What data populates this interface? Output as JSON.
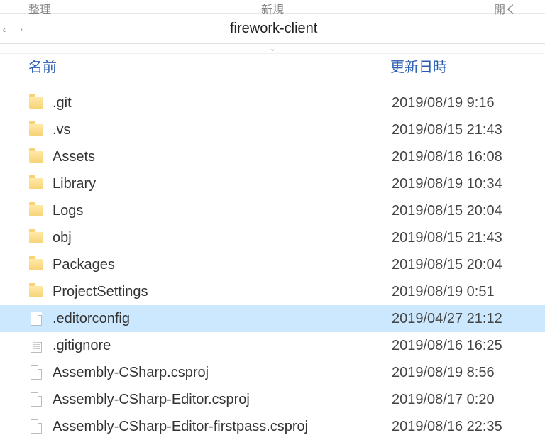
{
  "ribbon": {
    "group1": "整理",
    "group2": "新規",
    "group3": "開く"
  },
  "breadcrumb": {
    "current": "firework-client",
    "chevron": "⌄"
  },
  "columns": {
    "name": "名前",
    "date": "更新日時"
  },
  "files": [
    {
      "icon": "folder",
      "name": ".git",
      "date": "2019/08/19 9:16",
      "selected": false
    },
    {
      "icon": "folder",
      "name": ".vs",
      "date": "2019/08/15 21:43",
      "selected": false
    },
    {
      "icon": "folder",
      "name": "Assets",
      "date": "2019/08/18 16:08",
      "selected": false
    },
    {
      "icon": "folder",
      "name": "Library",
      "date": "2019/08/19 10:34",
      "selected": false
    },
    {
      "icon": "folder",
      "name": "Logs",
      "date": "2019/08/15 20:04",
      "selected": false
    },
    {
      "icon": "folder",
      "name": "obj",
      "date": "2019/08/15 21:43",
      "selected": false
    },
    {
      "icon": "folder",
      "name": "Packages",
      "date": "2019/08/15 20:04",
      "selected": false
    },
    {
      "icon": "folder",
      "name": "ProjectSettings",
      "date": "2019/08/19 0:51",
      "selected": false
    },
    {
      "icon": "file",
      "name": ".editorconfig",
      "date": "2019/04/27 21:12",
      "selected": true
    },
    {
      "icon": "file-lines",
      "name": ".gitignore",
      "date": "2019/08/16 16:25",
      "selected": false
    },
    {
      "icon": "file",
      "name": "Assembly-CSharp.csproj",
      "date": "2019/08/19 8:56",
      "selected": false
    },
    {
      "icon": "file",
      "name": "Assembly-CSharp-Editor.csproj",
      "date": "2019/08/17 0:20",
      "selected": false
    },
    {
      "icon": "file",
      "name": "Assembly-CSharp-Editor-firstpass.csproj",
      "date": "2019/08/16 22:35",
      "selected": false
    }
  ]
}
